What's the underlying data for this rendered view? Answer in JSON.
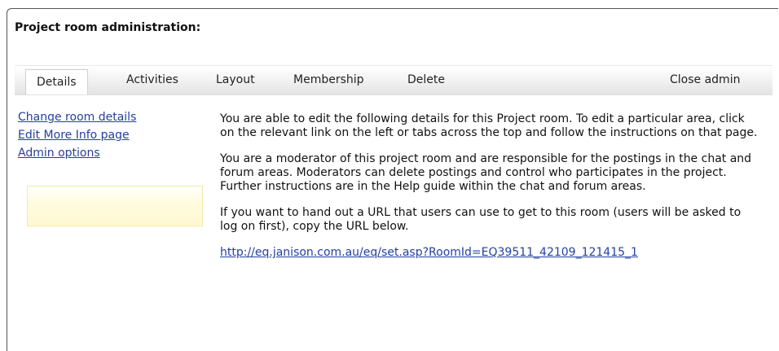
{
  "title": "Project room administration:",
  "tabs": {
    "details": "Details",
    "activities": "Activities",
    "layout": "Layout",
    "membership": "Membership",
    "delete": "Delete",
    "close_admin": "Close admin"
  },
  "sidebar": {
    "links": [
      "Change room details",
      "Edit More Info page",
      "Admin options"
    ]
  },
  "main": {
    "para1": "You are able to edit the following details for this Project room. To edit a particular area, click on the relevant link on the left or tabs across the top and follow the instructions on that page.",
    "para2": "You are a moderator of this project room and are responsible for the postings in the chat and forum areas. Moderators can delete postings and control who participates in the project. Further instructions are in the Help guide within the chat and forum areas.",
    "para3": "If you want to hand out a URL that users can use to get to this room (users will be asked to log on first), copy the URL below.",
    "url": "http://eq.janison.com.au/eq/set.asp?RoomId=EQ39511_42109_121415_1"
  },
  "colors": {
    "link": "#233fa2",
    "note_box": "#fff8d2"
  }
}
